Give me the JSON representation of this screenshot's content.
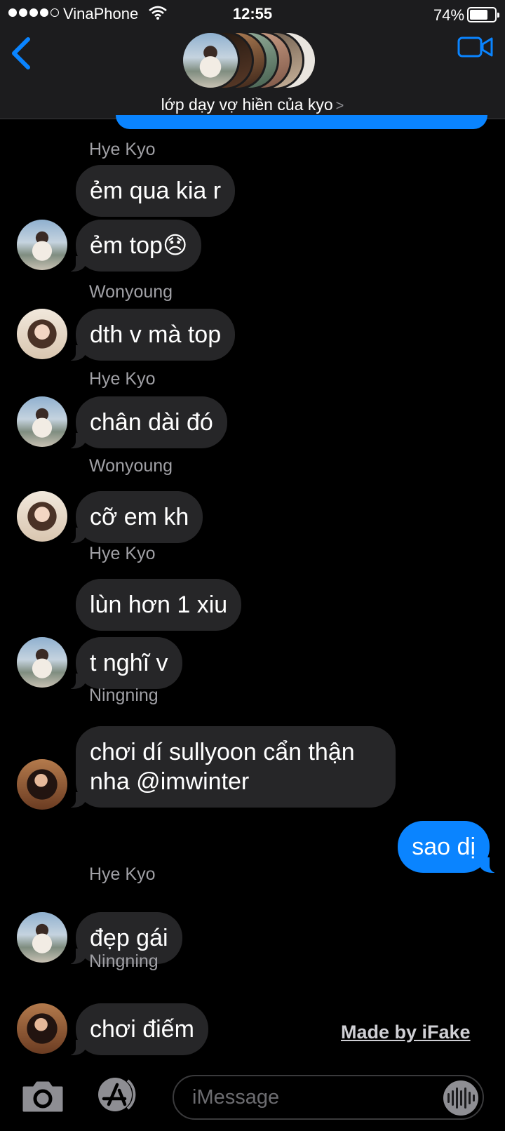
{
  "status_bar": {
    "carrier": "VinaPhone",
    "time": "12:55",
    "battery_percent": "74%",
    "battery_level": 0.74,
    "signal_bars_filled": 4,
    "signal_bars_total": 5
  },
  "header": {
    "group_name": "lớp dạy vợ hiền của kyo",
    "back_icon": "chevron-left-icon",
    "video_icon": "video-camera-icon"
  },
  "colors": {
    "accent_blue": "#0a84ff",
    "incoming_bubble": "#262628",
    "background": "#000000"
  },
  "messages": [
    {
      "sender": "Hye Kyo",
      "text": "ẻm qua kia r"
    },
    {
      "text": "ẻm top😞"
    },
    {
      "sender": "Wonyoung",
      "text": "dth v mà top"
    },
    {
      "sender": "Hye Kyo",
      "text": "chân dài đó"
    },
    {
      "sender": "Wonyoung",
      "text": "cỡ em kh"
    },
    {
      "sender": "Hye Kyo",
      "text": "lùn hơn 1 xiu"
    },
    {
      "text": "t nghĩ v"
    },
    {
      "sender": "Ningning",
      "text": "chơi dí sullyoon cẩn thận nha @imwinter"
    },
    {
      "text": "sao dị"
    },
    {
      "sender": "Hye Kyo",
      "text": "đẹp gái"
    },
    {
      "sender": "Ningning",
      "text": "chơi điếm"
    }
  ],
  "watermark": "Made by iFake",
  "input": {
    "placeholder": "iMessage",
    "camera_icon": "camera-icon",
    "apps_icon": "app-store-icon",
    "audio_icon": "audio-waveform-icon"
  }
}
